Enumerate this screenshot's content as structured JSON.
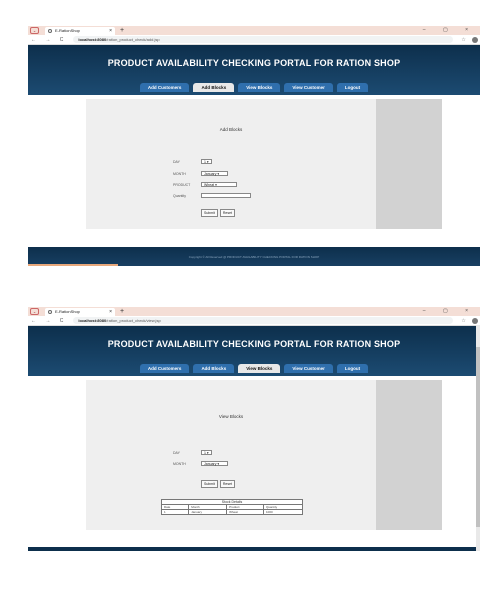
{
  "shot1": {
    "tab_title": "E-RationShop",
    "url_host": "localhost:8080",
    "url_path": "/ration_product_check/add.jsp",
    "site_title": "PRODUCT AVAILABILITY CHECKING PORTAL FOR RATION SHOP",
    "menu": [
      "Add Customers",
      "Add Blocks",
      "View Blocks",
      "View Customer",
      "Logout"
    ],
    "active_menu": "Add Blocks",
    "form_title": "Add Blocks",
    "fields": {
      "day_label": "DAY",
      "day_value": "1",
      "month_label": "MONTH",
      "month_value": "January",
      "product_label": "PRODUCT",
      "product_value": "Wheat",
      "quantity_label": "Quantity"
    },
    "submit_label": "Submit",
    "reset_label": "Reset",
    "footer_text": "Copyright © All Reserved @ PRODUCT AVAILABILITY CHECKING PORTAL FOR RATION SHOP"
  },
  "shot2": {
    "tab_title": "E-RationShop",
    "url_host": "localhost:8080",
    "url_path": "/ration_product_check/view.jsp",
    "site_title": "PRODUCT AVAILABILITY CHECKING PORTAL FOR RATION SHOP",
    "menu": [
      "Add Customers",
      "Add Blocks",
      "View Blocks",
      "View Customer",
      "Logout"
    ],
    "active_menu": "View Blocks",
    "form_title": "View Blocks",
    "fields": {
      "day_label": "DAY",
      "day_value": "1",
      "month_label": "MONTH",
      "month_value": "January"
    },
    "submit_label": "Submit",
    "reset_label": "Reset",
    "table": {
      "caption": "Stock Details",
      "headers": [
        "Date",
        "Month",
        "Product",
        "Quantity"
      ],
      "rows": [
        [
          "1",
          "January",
          "Wheat",
          "1000"
        ]
      ]
    }
  },
  "colors": {
    "header": "#0d2f4c",
    "menu": "#2f6fad",
    "panel": "#d2d2d2"
  }
}
